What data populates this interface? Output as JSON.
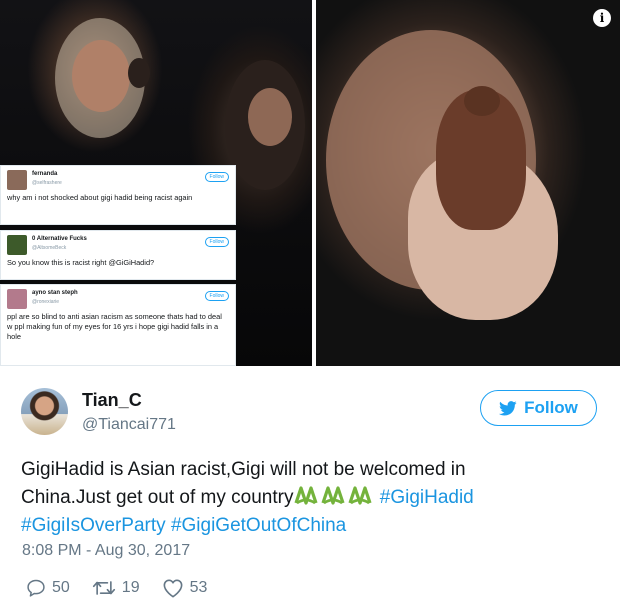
{
  "media": {
    "info_icon": "info-icon",
    "embedded_tweets": [
      {
        "name": "fernanda",
        "handle": "@selfrashere",
        "follow_label": "Follow",
        "text": "why am i not shocked about gigi hadid being racist again",
        "avatar_color": "#8a6a5a"
      },
      {
        "name": "0 Alternative Fucks",
        "handle": "@AltsomeBeck",
        "follow_label": "Follow",
        "text": "So you know this is racist right @GiGiHadid?",
        "avatar_color": "#3d5a2a"
      },
      {
        "name": "ayno stan steph",
        "handle": "@ronexiarie",
        "follow_label": "Follow",
        "text": "ppl are so blind to anti asian racism as someone thats had to deal w ppl making fun of my eyes for 16 yrs i hope gigi hadid falls in a hole",
        "avatar_color": "#b37a8c"
      }
    ]
  },
  "tweet": {
    "display_name": "Tian_C",
    "handle": "@Tiancai771",
    "follow_label": "Follow",
    "text_line1": "GigiHadid is Asian racist,Gigi will not be welcomed in",
    "text_line2_plain": "China.Just get out of my country",
    "emoji_icon": "vomiting-face-icon",
    "text_line2_tag": "#GigiHadid",
    "text_line3_tag1": "#GigiIsOverParty",
    "text_line3_tag2": "#GigiGetOutOfChina",
    "timestamp": "8:08 PM - Aug 30, 2017",
    "replies": "50",
    "retweets": "19",
    "likes": "53"
  },
  "colors": {
    "accent": "#1da1f2",
    "hashtag": "#1b95e0",
    "muted": "#657786",
    "text": "#14171a",
    "emoji_green": "#74b33c"
  }
}
